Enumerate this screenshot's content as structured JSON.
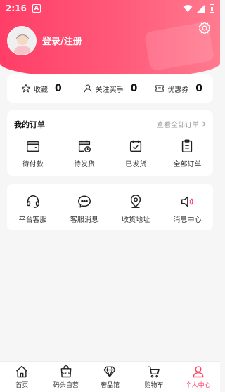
{
  "status_bar": {
    "time": "2:16",
    "notification_icon": "A"
  },
  "profile": {
    "login_label": "登录/注册"
  },
  "stats": [
    {
      "icon": "star-icon",
      "label": "收藏",
      "count": "0"
    },
    {
      "icon": "user-icon",
      "label": "关注买手",
      "count": "0"
    },
    {
      "icon": "coupon-icon",
      "label": "优惠券",
      "count": "0"
    }
  ],
  "orders": {
    "title": "我的订单",
    "view_all": "查看全部订单",
    "items": [
      {
        "icon": "wallet-icon",
        "label": "待付款"
      },
      {
        "icon": "calendar-clock-icon",
        "label": "待发货"
      },
      {
        "icon": "calendar-check-icon",
        "label": "已发货"
      },
      {
        "icon": "clipboard-icon",
        "label": "全部订单"
      }
    ]
  },
  "services": {
    "items": [
      {
        "icon": "headset-icon",
        "label": "平台客服"
      },
      {
        "icon": "chat-icon",
        "label": "客服消息"
      },
      {
        "icon": "location-icon",
        "label": "收货地址"
      },
      {
        "icon": "speaker-icon",
        "label": "消息中心"
      }
    ]
  },
  "tabbar": {
    "items": [
      {
        "icon": "home-icon",
        "label": "首页"
      },
      {
        "icon": "shopping-bag-icon",
        "label": "码头自营",
        "badge_text": "SALE"
      },
      {
        "icon": "diamond-icon",
        "label": "奢品馆"
      },
      {
        "icon": "cart-icon",
        "label": "购物车"
      },
      {
        "icon": "person-icon",
        "label": "个人中心"
      }
    ],
    "active_index": 4
  },
  "colors": {
    "accent": "#ff3e67",
    "header_gradient_end": "#ff7b8f",
    "background": "#f6f6f6"
  }
}
